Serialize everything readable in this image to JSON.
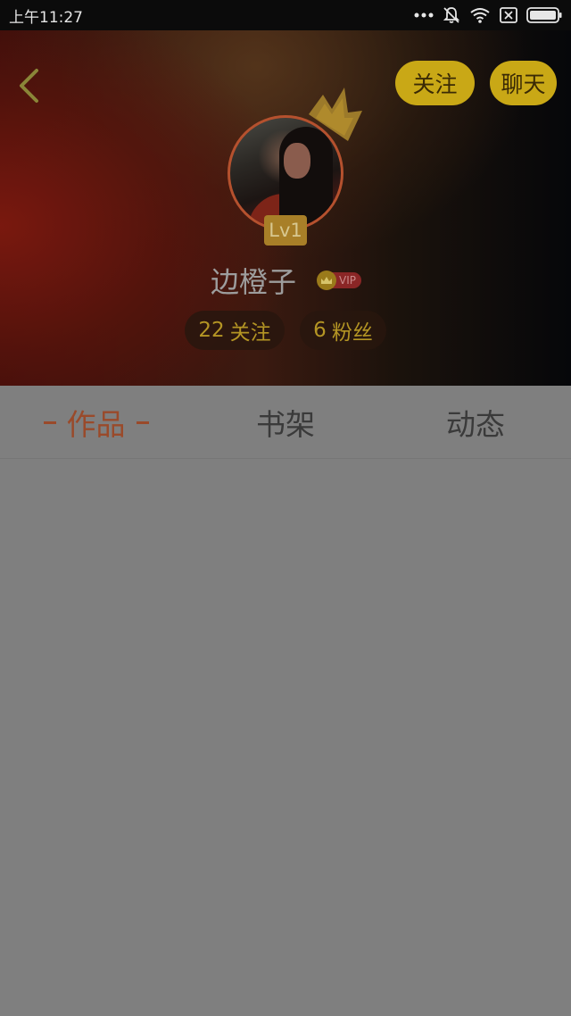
{
  "status_bar": {
    "time": "上午11:27",
    "icons": [
      "more-dots-icon",
      "bell-off-icon",
      "wifi-icon",
      "sim-off-icon",
      "battery-icon"
    ]
  },
  "header": {
    "back_icon": "chevron-left-icon",
    "follow_label": "关注",
    "chat_label": "聊天",
    "level": "Lv1",
    "username": "边橙子",
    "vip_label": "VIP",
    "follows_count": "22",
    "follows_label": "关注",
    "fans_count": "6",
    "fans_label": "粉丝"
  },
  "tabs": [
    {
      "label": "作品",
      "active": true
    },
    {
      "label": "书架",
      "active": false
    },
    {
      "label": "动态",
      "active": false
    }
  ],
  "colors": {
    "accent_yellow": "#c9a816",
    "active_tab": "#9a4a2a",
    "overlay_gray": "#7f7f7f"
  }
}
